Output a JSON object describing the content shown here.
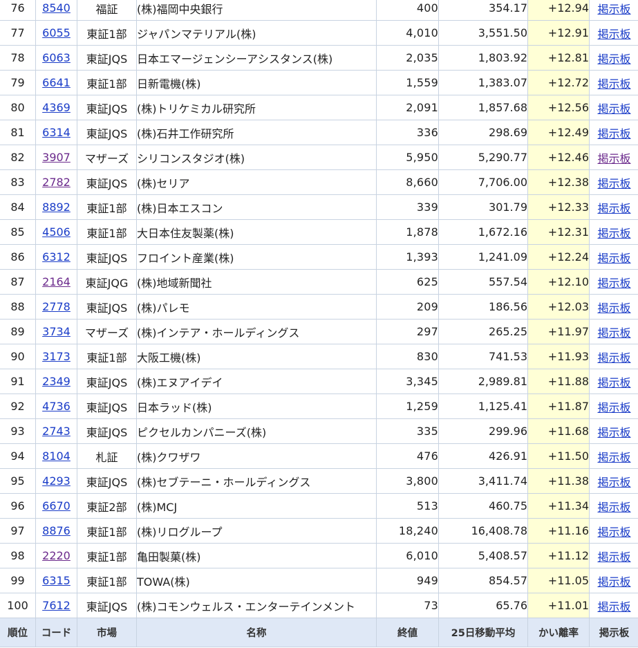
{
  "table": {
    "columns": [
      "順位",
      "コード",
      "市場",
      "名称",
      "終値",
      "25日移動平均",
      "かい離率",
      "掲示板"
    ],
    "rows": [
      {
        "rank": "76",
        "code": "8540",
        "market": "福証",
        "name": "(株)福岡中央銀行",
        "close": "400",
        "ma25": "354.17",
        "deviation": "+12.94",
        "board": "掲示板",
        "code_visited": false,
        "board_visited": false
      },
      {
        "rank": "77",
        "code": "6055",
        "market": "東証1部",
        "name": "ジャパンマテリアル(株)",
        "close": "4,010",
        "ma25": "3,551.50",
        "deviation": "+12.91",
        "board": "掲示板",
        "code_visited": false,
        "board_visited": false
      },
      {
        "rank": "78",
        "code": "6063",
        "market": "東証JQS",
        "name": "日本エマージェンシーアシスタンス(株)",
        "close": "2,035",
        "ma25": "1,803.92",
        "deviation": "+12.81",
        "board": "掲示板",
        "code_visited": false,
        "board_visited": false
      },
      {
        "rank": "79",
        "code": "6641",
        "market": "東証1部",
        "name": "日新電機(株)",
        "close": "1,559",
        "ma25": "1,383.07",
        "deviation": "+12.72",
        "board": "掲示板",
        "code_visited": false,
        "board_visited": false
      },
      {
        "rank": "80",
        "code": "4369",
        "market": "東証JQS",
        "name": "(株)トリケミカル研究所",
        "close": "2,091",
        "ma25": "1,857.68",
        "deviation": "+12.56",
        "board": "掲示板",
        "code_visited": false,
        "board_visited": false
      },
      {
        "rank": "81",
        "code": "6314",
        "market": "東証JQS",
        "name": "(株)石井工作研究所",
        "close": "336",
        "ma25": "298.69",
        "deviation": "+12.49",
        "board": "掲示板",
        "code_visited": false,
        "board_visited": false
      },
      {
        "rank": "82",
        "code": "3907",
        "market": "マザーズ",
        "name": "シリコンスタジオ(株)",
        "close": "5,950",
        "ma25": "5,290.77",
        "deviation": "+12.46",
        "board": "掲示板",
        "code_visited": true,
        "board_visited": true
      },
      {
        "rank": "83",
        "code": "2782",
        "market": "東証JQS",
        "name": "(株)セリア",
        "close": "8,660",
        "ma25": "7,706.00",
        "deviation": "+12.38",
        "board": "掲示板",
        "code_visited": true,
        "board_visited": false
      },
      {
        "rank": "84",
        "code": "8892",
        "market": "東証1部",
        "name": "(株)日本エスコン",
        "close": "339",
        "ma25": "301.79",
        "deviation": "+12.33",
        "board": "掲示板",
        "code_visited": false,
        "board_visited": false
      },
      {
        "rank": "85",
        "code": "4506",
        "market": "東証1部",
        "name": "大日本住友製薬(株)",
        "close": "1,878",
        "ma25": "1,672.16",
        "deviation": "+12.31",
        "board": "掲示板",
        "code_visited": false,
        "board_visited": false
      },
      {
        "rank": "86",
        "code": "6312",
        "market": "東証JQS",
        "name": "フロイント産業(株)",
        "close": "1,393",
        "ma25": "1,241.09",
        "deviation": "+12.24",
        "board": "掲示板",
        "code_visited": false,
        "board_visited": false
      },
      {
        "rank": "87",
        "code": "2164",
        "market": "東証JQG",
        "name": "(株)地域新聞社",
        "close": "625",
        "ma25": "557.54",
        "deviation": "+12.10",
        "board": "掲示板",
        "code_visited": true,
        "board_visited": false
      },
      {
        "rank": "88",
        "code": "2778",
        "market": "東証JQS",
        "name": "(株)パレモ",
        "close": "209",
        "ma25": "186.56",
        "deviation": "+12.03",
        "board": "掲示板",
        "code_visited": false,
        "board_visited": false
      },
      {
        "rank": "89",
        "code": "3734",
        "market": "マザーズ",
        "name": "(株)インテア・ホールディングス",
        "close": "297",
        "ma25": "265.25",
        "deviation": "+11.97",
        "board": "掲示板",
        "code_visited": false,
        "board_visited": false
      },
      {
        "rank": "90",
        "code": "3173",
        "market": "東証1部",
        "name": "大阪工機(株)",
        "close": "830",
        "ma25": "741.53",
        "deviation": "+11.93",
        "board": "掲示板",
        "code_visited": false,
        "board_visited": false
      },
      {
        "rank": "91",
        "code": "2349",
        "market": "東証JQS",
        "name": "(株)エヌアイデイ",
        "close": "3,345",
        "ma25": "2,989.81",
        "deviation": "+11.88",
        "board": "掲示板",
        "code_visited": false,
        "board_visited": false
      },
      {
        "rank": "92",
        "code": "4736",
        "market": "東証JQS",
        "name": "日本ラッド(株)",
        "close": "1,259",
        "ma25": "1,125.41",
        "deviation": "+11.87",
        "board": "掲示板",
        "code_visited": false,
        "board_visited": false
      },
      {
        "rank": "93",
        "code": "2743",
        "market": "東証JQS",
        "name": "ピクセルカンパニーズ(株)",
        "close": "335",
        "ma25": "299.96",
        "deviation": "+11.68",
        "board": "掲示板",
        "code_visited": false,
        "board_visited": false
      },
      {
        "rank": "94",
        "code": "8104",
        "market": "札証",
        "name": "(株)クワザワ",
        "close": "476",
        "ma25": "426.91",
        "deviation": "+11.50",
        "board": "掲示板",
        "code_visited": false,
        "board_visited": false
      },
      {
        "rank": "95",
        "code": "4293",
        "market": "東証JQS",
        "name": "(株)セブテーニ・ホールディングス",
        "close": "3,800",
        "ma25": "3,411.74",
        "deviation": "+11.38",
        "board": "掲示板",
        "code_visited": false,
        "board_visited": false
      },
      {
        "rank": "96",
        "code": "6670",
        "market": "東証2部",
        "name": "(株)MCJ",
        "close": "513",
        "ma25": "460.75",
        "deviation": "+11.34",
        "board": "掲示板",
        "code_visited": false,
        "board_visited": false
      },
      {
        "rank": "97",
        "code": "8876",
        "market": "東証1部",
        "name": "(株)リログループ",
        "close": "18,240",
        "ma25": "16,408.78",
        "deviation": "+11.16",
        "board": "掲示板",
        "code_visited": false,
        "board_visited": false
      },
      {
        "rank": "98",
        "code": "2220",
        "market": "東証1部",
        "name": "亀田製菓(株)",
        "close": "6,010",
        "ma25": "5,408.57",
        "deviation": "+11.12",
        "board": "掲示板",
        "code_visited": true,
        "board_visited": false
      },
      {
        "rank": "99",
        "code": "6315",
        "market": "東証1部",
        "name": "TOWA(株)",
        "close": "949",
        "ma25": "854.57",
        "deviation": "+11.05",
        "board": "掲示板",
        "code_visited": false,
        "board_visited": false
      },
      {
        "rank": "100",
        "code": "7612",
        "market": "東証JQS",
        "name": "(株)コモンウェルス・エンターテインメント",
        "close": "73",
        "ma25": "65.76",
        "deviation": "+11.01",
        "board": "掲示板",
        "code_visited": false,
        "board_visited": false
      }
    ]
  },
  "colors": {
    "link": "#1a3cc8",
    "visited_link": "#6b2a8c",
    "deviation_bg": "#ffffd6",
    "header_bg": "#dfe8f6",
    "border": "#c8d3e1"
  }
}
